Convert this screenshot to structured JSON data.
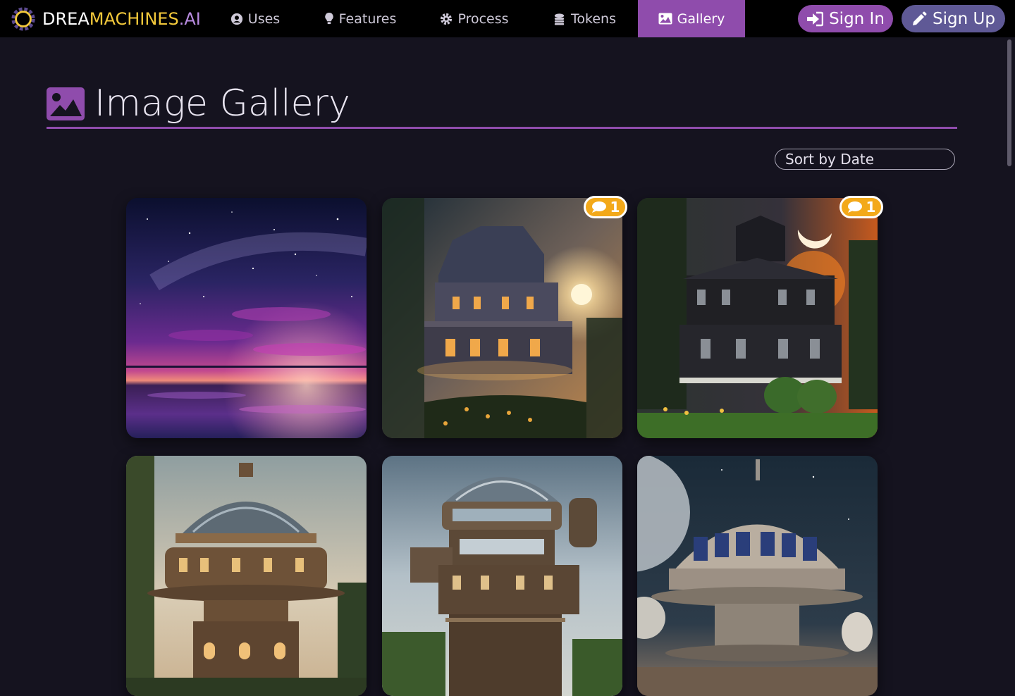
{
  "nav": {
    "brand": {
      "part1": "DREA",
      "part2": "MACHINES",
      "part3": ".AI",
      "logo_icon": "gear-sun-logo"
    },
    "items": [
      {
        "label": "Uses",
        "icon": "user-circle-icon"
      },
      {
        "label": "Features",
        "icon": "lightbulb-icon"
      },
      {
        "label": "Process",
        "icon": "gear-icon"
      },
      {
        "label": "Tokens",
        "icon": "coins-icon"
      },
      {
        "label": "Gallery",
        "icon": "image-icon",
        "active": true
      }
    ],
    "sign_in": {
      "label": "Sign In",
      "icon": "sign-in-icon"
    },
    "sign_up": {
      "label": "Sign Up",
      "icon": "pencil-icon"
    }
  },
  "page": {
    "title": "Image Gallery",
    "title_icon": "image-icon",
    "sort": {
      "value": "Sort by Date"
    }
  },
  "gallery": {
    "images": [
      {
        "subject": "starry-lake-sunset",
        "comments": null
      },
      {
        "subject": "victorian-house-moonlight",
        "comments": "1"
      },
      {
        "subject": "victorian-house-garden",
        "comments": "1"
      },
      {
        "subject": "steampunk-dome-tower",
        "comments": null
      },
      {
        "subject": "steampunk-observatory-tower",
        "comments": null
      },
      {
        "subject": "space-station-dome",
        "comments": null
      }
    ]
  },
  "colors": {
    "background": "#15131f",
    "navbar": "#000000",
    "accent": "#8f4cac",
    "signup": "#5f5996",
    "badge": "#f3a91a",
    "brand_gold": "#f3c93b"
  }
}
